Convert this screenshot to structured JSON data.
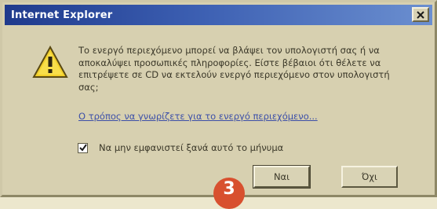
{
  "window": {
    "title": "Internet Explorer"
  },
  "dialog": {
    "message": "Το ενεργό περιεχόμενο μπορεί να βλάψει τον υπολογιστή σας ή να αποκαλύψει προσωπικές πληροφορίες. Είστε βέβαιοι ότι θέλετε να επιτρέψετε σε CD να εκτελούν ενεργό περιεχόμενο στον υπολογιστή σας;",
    "link_text": "Ο τρόπος να γνωρίζετε για το ενεργό περιεχόμενο...",
    "checkbox_label": "Να μην εμφανιστεί ξανά αυτό το μήνυμα",
    "checkbox_checked": true,
    "buttons": {
      "yes_label": "Ναι",
      "no_label": "Όχι"
    }
  },
  "annotation": {
    "step_number": "3",
    "color": "#d8502f"
  },
  "icons": {
    "warning": "warning-triangle-icon",
    "close": "close-icon",
    "check": "checkmark-icon"
  }
}
